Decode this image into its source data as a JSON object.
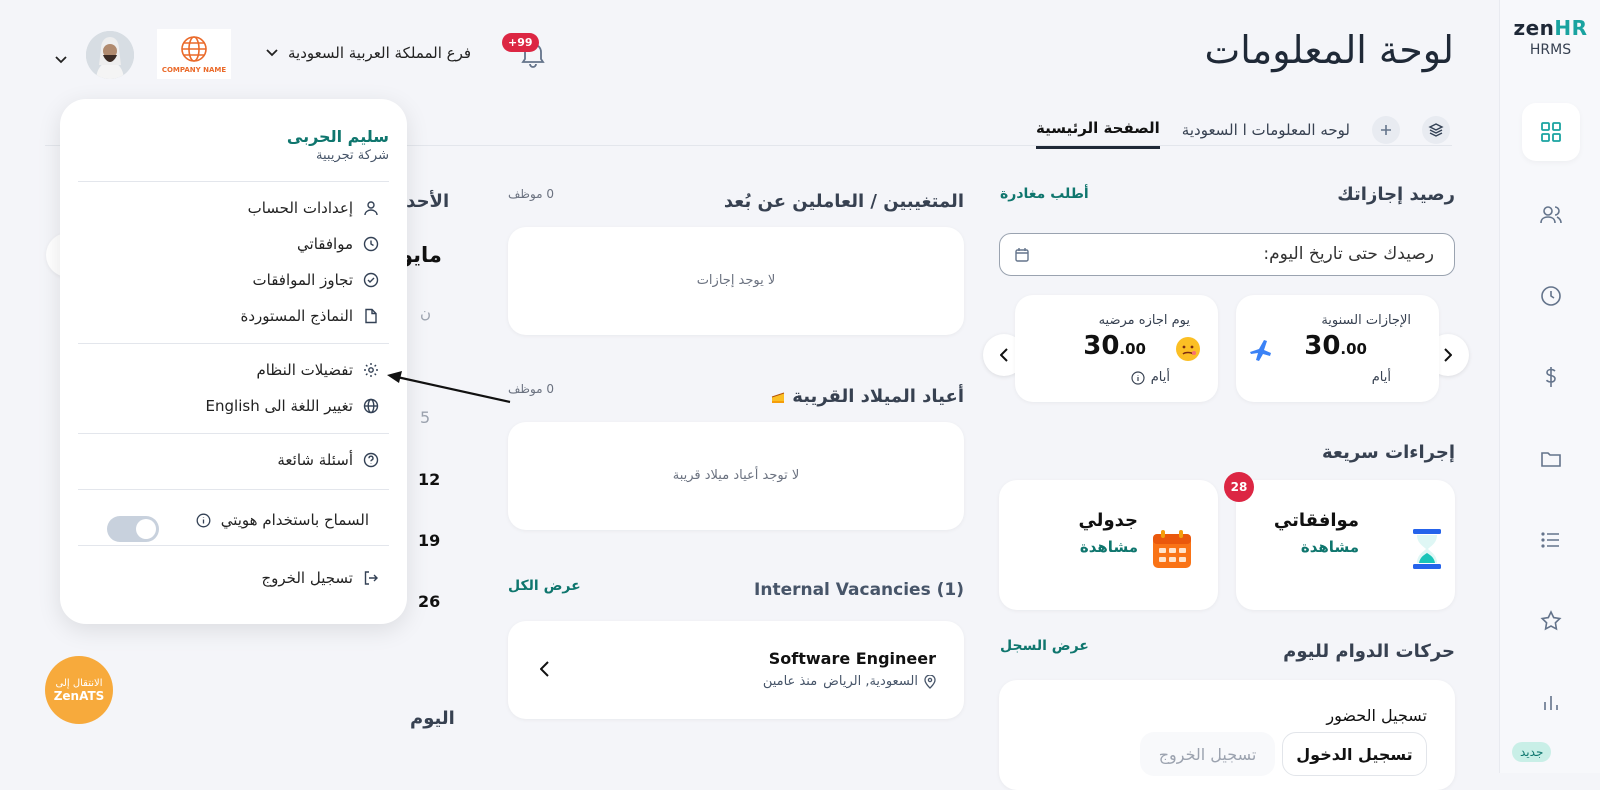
{
  "app": {
    "brand_zen": "zen",
    "brand_hr": "HR",
    "brand_sub": "HRMS",
    "new_label": "جديد"
  },
  "sidebar": {
    "items": [
      {
        "icon": "dashboard-icon"
      },
      {
        "icon": "users-icon"
      },
      {
        "icon": "clock-icon"
      },
      {
        "icon": "dollar-icon"
      },
      {
        "icon": "folder-icon"
      },
      {
        "icon": "list-icon"
      },
      {
        "icon": "star-icon"
      },
      {
        "icon": "chart-icon"
      }
    ]
  },
  "header": {
    "title": "لوحة المعلومات",
    "branch": "فرع المملكة العربية السعودية",
    "notifications": "+99",
    "company_logo_text": "COMPANY NAME"
  },
  "tabs": [
    {
      "label": "الصفحة الرئيسية",
      "active": true
    },
    {
      "label": "لوحه المعلومات ا السعودية",
      "active": false
    }
  ],
  "leave": {
    "title": "رصيد إجازاتك",
    "request": "أطلب مغادرة",
    "date_label": "رصيدك حتى تاريخ اليوم:",
    "cards": [
      {
        "label": "الإجازات السنوية",
        "value": "30",
        "decimals": ".00",
        "unit": "أيام"
      },
      {
        "label": "يوم اجازه مرضيه",
        "value": "30",
        "decimals": ".00",
        "unit": "أيام"
      }
    ]
  },
  "quick": {
    "title": "إجراءات سريعة",
    "items": [
      {
        "label": "موافقاتي",
        "action": "مشاهدة",
        "badge": "28"
      },
      {
        "label": "جدولي",
        "action": "مشاهدة"
      }
    ]
  },
  "attendance": {
    "title": "حركات الدوام لليوم",
    "link": "عرض السجل",
    "sub": "تسجيل الحضور",
    "checkin": "تسجيل الدخول",
    "checkout": "تسجيل الخروج"
  },
  "absent": {
    "title": "المتغيبين / العاملين عن بُعد",
    "count": "0 موظف",
    "empty": "لا يوجد إجازات"
  },
  "birthdays": {
    "title": "أعياد الميلاد القريبة",
    "count": "0 موظف",
    "empty": "لا توجد أعياد ميلاد قريبة"
  },
  "vacancies": {
    "title": "Internal Vacancies (1)",
    "link": "عرض الكل",
    "job": "Software Engineer",
    "location": "السعودية, الرياض",
    "age": "منذ عامين"
  },
  "calendar": {
    "title": "الأحدا",
    "month": "مايو",
    "day_header": "ن",
    "days": [
      "5",
      "12",
      "19",
      "26"
    ],
    "today": "اليوم"
  },
  "menu": {
    "name": "سليم الحربى",
    "company": "شركة تجريبية",
    "items": [
      {
        "label": "إعدادات الحساب",
        "icon": "user-icon"
      },
      {
        "label": "موافقاتي",
        "icon": "clock-icon"
      },
      {
        "label": "تجاوز الموافقات",
        "icon": "check-circle-icon"
      },
      {
        "label": "النماذج المستوردة",
        "icon": "file-icon"
      },
      {
        "label": "تفضيلات النظام",
        "icon": "gear-icon"
      },
      {
        "label": "تغيير اللغة الى English",
        "icon": "globe-icon"
      },
      {
        "label": "أسئلة شائعة",
        "icon": "help-icon"
      },
      {
        "label": "السماح باستخدام هويتي",
        "icon": "info-icon"
      },
      {
        "label": "تسجيل الخروج",
        "icon": "logout-icon"
      }
    ]
  },
  "zenats": {
    "line1": "الانتقال إلى",
    "line2": "ZenATS"
  }
}
